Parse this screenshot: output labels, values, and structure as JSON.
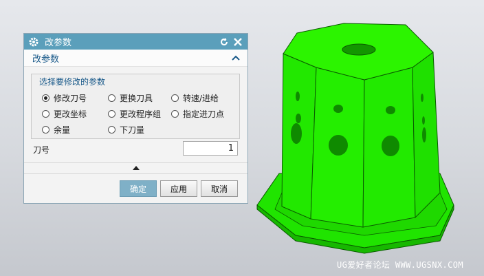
{
  "dialog": {
    "title": "改参数",
    "icons": {
      "settings": "gear-icon",
      "reset": "refresh-icon",
      "close": "close-icon"
    },
    "section_label": "改参数",
    "group_title": "选择要修改的参数",
    "options": [
      {
        "label": "修改刀号",
        "selected": true
      },
      {
        "label": "更换刀具",
        "selected": false
      },
      {
        "label": "转速/进给",
        "selected": false
      },
      {
        "label": "更改坐标",
        "selected": false
      },
      {
        "label": "更改程序组",
        "selected": false
      },
      {
        "label": "指定进刀点",
        "selected": false
      },
      {
        "label": "余量",
        "selected": false
      },
      {
        "label": "下刀量",
        "selected": false
      }
    ],
    "field": {
      "label": "刀号",
      "value": "1"
    },
    "buttons": {
      "ok": "确定",
      "apply": "应用",
      "cancel": "取消"
    }
  },
  "viewport": {
    "model_color": "#22ee00",
    "watermark": "UG爱好者论坛 WWW.UGSNX.COM"
  }
}
